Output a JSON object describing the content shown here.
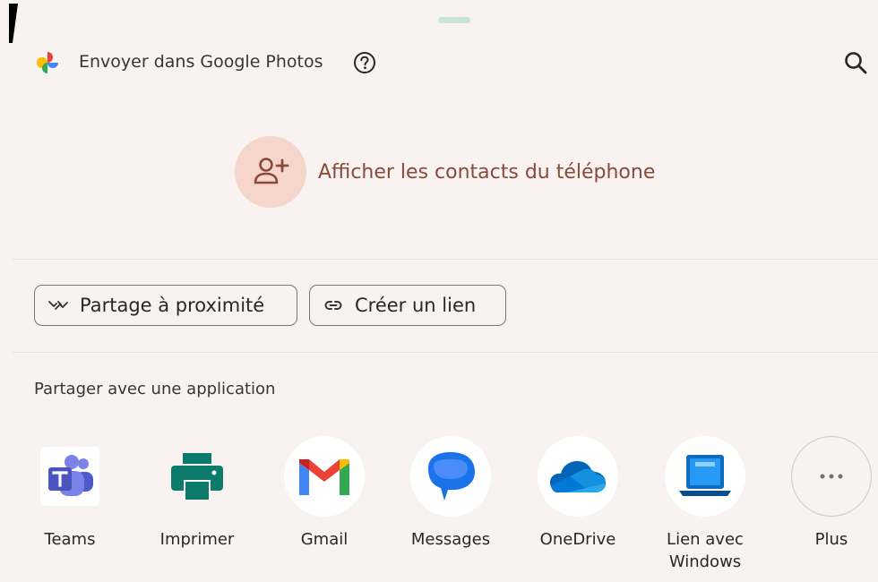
{
  "header": {
    "title": "Envoyer dans Google Photos",
    "logo_icon": "google-photos-pinwheel-icon",
    "help_icon": "help-circle-icon",
    "search_icon": "search-icon"
  },
  "contacts": {
    "label": "Afficher les contacts du téléphone",
    "icon": "person-add-icon"
  },
  "chips": [
    {
      "label": "Partage à proximité",
      "icon": "nearby-share-icon"
    },
    {
      "label": "Créer un lien",
      "icon": "link-icon"
    }
  ],
  "share_section": {
    "label": "Partager avec une application"
  },
  "apps": [
    {
      "label": "Teams",
      "icon": "teams-icon"
    },
    {
      "label": "Imprimer",
      "icon": "printer-icon"
    },
    {
      "label": "Gmail",
      "icon": "gmail-icon"
    },
    {
      "label": "Messages",
      "icon": "messages-icon"
    },
    {
      "label": "OneDrive",
      "icon": "onedrive-icon"
    },
    {
      "label": "Lien avec\nWindows",
      "icon": "link-to-windows-icon"
    },
    {
      "label": "Plus",
      "icon": "more-horizontal-icon"
    }
  ],
  "colors": {
    "sheet_background": "#f8f2f1",
    "accent_text": "#8a4a3b",
    "accent_container": "#f6d5cc",
    "handle": "#c9e3d9"
  }
}
